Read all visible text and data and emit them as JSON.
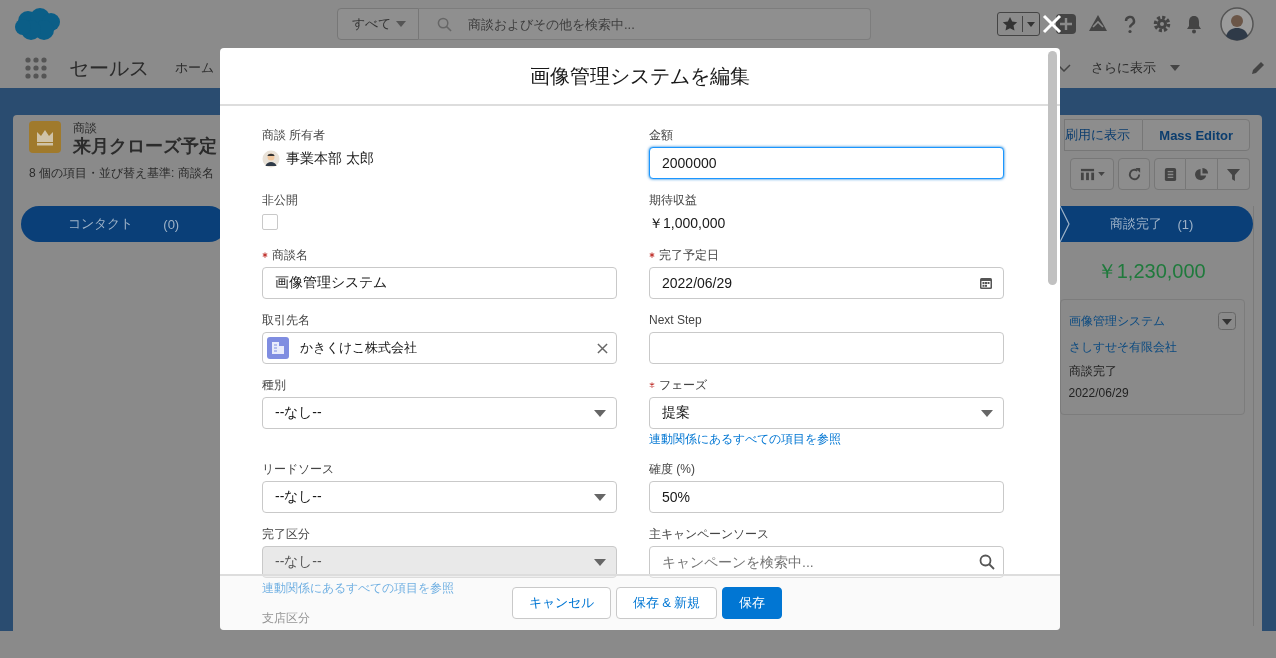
{
  "global_header": {
    "search_scope": "すべて",
    "search_placeholder": "商談およびその他を検索中..."
  },
  "nav": {
    "app_name": "セールス",
    "items": [
      {
        "label": "ホーム"
      }
    ],
    "more": "さらに表示"
  },
  "list_view": {
    "object": "商談",
    "title": "来月クローズ予定",
    "summary": "8 個の項目・並び替え基準: 商談名",
    "buttons": [
      "刷用に表示",
      "Mass Editor"
    ],
    "columns": [
      {
        "name": "コンタクト",
        "count": "(0)"
      },
      {
        "name": "商談完了",
        "count": "(1)",
        "total": "￥1,230,000",
        "cards": [
          {
            "title": "画像管理システム",
            "account": "さしすせそ有限会社",
            "stage": "商談完了",
            "date": "2022/06/29"
          }
        ]
      }
    ]
  },
  "modal": {
    "title": "画像管理システムを編集",
    "fields": [
      {
        "kind": "user",
        "label": "商談 所有者",
        "value": "事業本部 太郎"
      },
      {
        "kind": "text",
        "label": "金額",
        "value": "2000000",
        "focused": true
      },
      {
        "kind": "checkbox",
        "label": "非公開",
        "checked": false
      },
      {
        "kind": "readonly",
        "label": "期待収益",
        "value": "￥1,000,000"
      },
      {
        "kind": "text",
        "label": "商談名",
        "required": true,
        "value": "画像管理システム",
        "focused": false
      },
      {
        "kind": "date",
        "label": "完了予定日",
        "required": true,
        "value": "2022/06/29"
      },
      {
        "kind": "lookup",
        "label": "取引先名",
        "value": "かきくけこ株式会社"
      },
      {
        "kind": "text",
        "label": "Next Step",
        "focused": false
      },
      {
        "kind": "picklist",
        "label": "種別",
        "value": "--なし--",
        "disabled": false
      },
      {
        "kind": "picklist",
        "label": "フェーズ",
        "required": true,
        "value": "提案",
        "disabled": false,
        "help_link": "連動関係にあるすべての項目を参照"
      },
      {
        "kind": "picklist",
        "label": "リードソース",
        "value": "--なし--",
        "disabled": false
      },
      {
        "kind": "text",
        "label": "確度 (%)",
        "value": "50%",
        "focused": false
      },
      {
        "kind": "picklist",
        "label": "完了区分",
        "value": "--なし--",
        "disabled": true,
        "help_link": "連動関係にあるすべての項目を参照"
      },
      {
        "kind": "search",
        "label": "主キャンペーンソース",
        "placeholder": "キャンペーンを検索中..."
      },
      {
        "kind": "label",
        "label": "支店区分"
      }
    ],
    "buttons": [
      {
        "label": "キャンセル",
        "kind": "neutral"
      },
      {
        "label": "保存 & 新規",
        "kind": "neutral"
      },
      {
        "label": "保存",
        "kind": "brand"
      }
    ]
  }
}
